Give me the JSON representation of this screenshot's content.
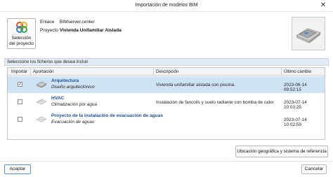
{
  "window": {
    "title": "Importación de modelos BIM",
    "close_glyph": "✕"
  },
  "project_button": {
    "label_line1": "Selección",
    "label_line2": "del proyecto",
    "icon": "bimserver-logo-icon"
  },
  "info": {
    "link_key": "Enlace",
    "link_value": "BIMserver.center",
    "project_key": "Proyecto",
    "project_value": "Vivienda Unifamiliar Aislada"
  },
  "group_header": "Seleccione los ficheros que desea incluir",
  "table": {
    "headers": {
      "import": "Importar",
      "contribution": "Aportación",
      "description": "Descripción",
      "last_change": "Último cambio"
    },
    "rows": [
      {
        "name": "Arquitectura",
        "subtitle": "Diseño arquitectónico",
        "description": "Vivienda unifamiliar aislada con piscina.",
        "date": "2023-06-14 09:52:15",
        "checked": true,
        "check_glyph": "✓",
        "icon": "architecture-model-icon"
      },
      {
        "name": "HVAC",
        "subtitle": "Climatización por agua",
        "description": "Instalación de fancoils y suelo radiante con bomba de calor",
        "date": "2023-07-14 10:03:25",
        "checked": false,
        "check_glyph": "",
        "icon": "hvac-model-icon"
      },
      {
        "name": "Proyecto de la instalación de evacuación de aguas",
        "subtitle": "Evacuación de aguas",
        "description": "",
        "date": "2023-07-14 10:02:59",
        "checked": false,
        "check_glyph": "",
        "icon": "drainage-model-icon"
      }
    ]
  },
  "geo_button": "Ubicación geográfica y sistema de referencia",
  "footer": {
    "accept": "Aceptar",
    "cancel": "Cancelar"
  },
  "colors": {
    "accent": "#1f4e9b",
    "selected_row": "#cfe3f6",
    "group_header": "#e3ebf5"
  }
}
